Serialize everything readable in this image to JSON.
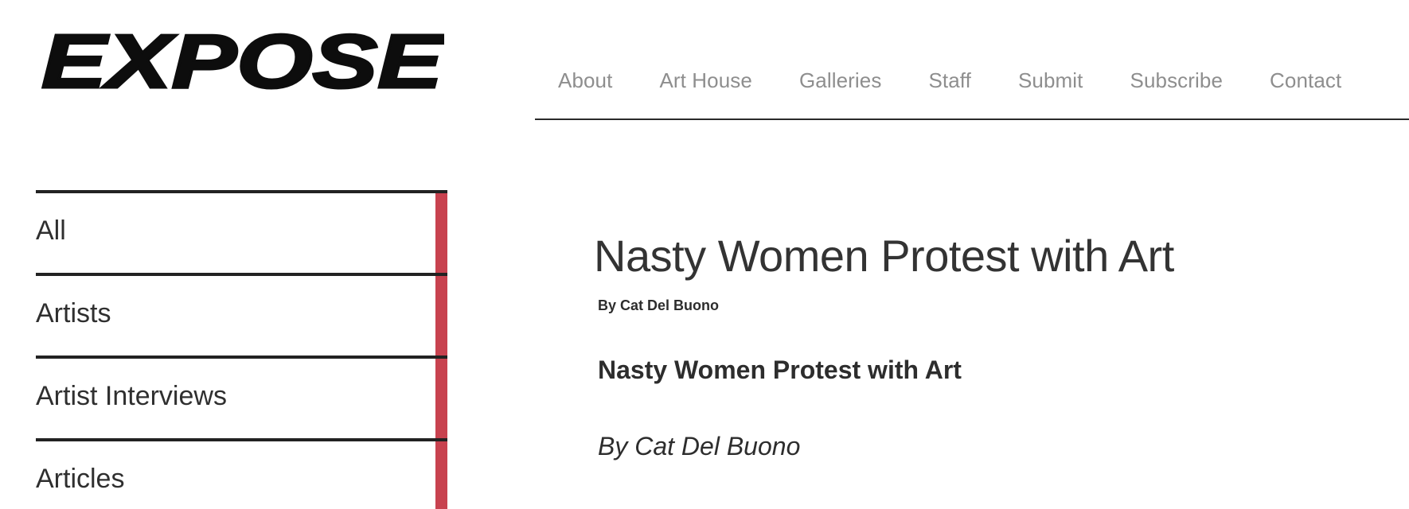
{
  "logo": {
    "text": "EXPOSE"
  },
  "nav": {
    "items": [
      {
        "label": "About"
      },
      {
        "label": "Art House"
      },
      {
        "label": "Galleries"
      },
      {
        "label": "Staff"
      },
      {
        "label": "Submit"
      },
      {
        "label": "Subscribe"
      },
      {
        "label": "Contact"
      }
    ]
  },
  "sidebar": {
    "accent_color": "#c8424f",
    "items": [
      {
        "label": "All"
      },
      {
        "label": "Artists"
      },
      {
        "label": "Artist Interviews"
      },
      {
        "label": "Articles"
      }
    ]
  },
  "article": {
    "title": "Nasty Women Protest with Art",
    "byline": "By Cat Del Buono",
    "heading": "Nasty Women Protest with Art",
    "byline_italic": "By Cat Del Buono"
  }
}
